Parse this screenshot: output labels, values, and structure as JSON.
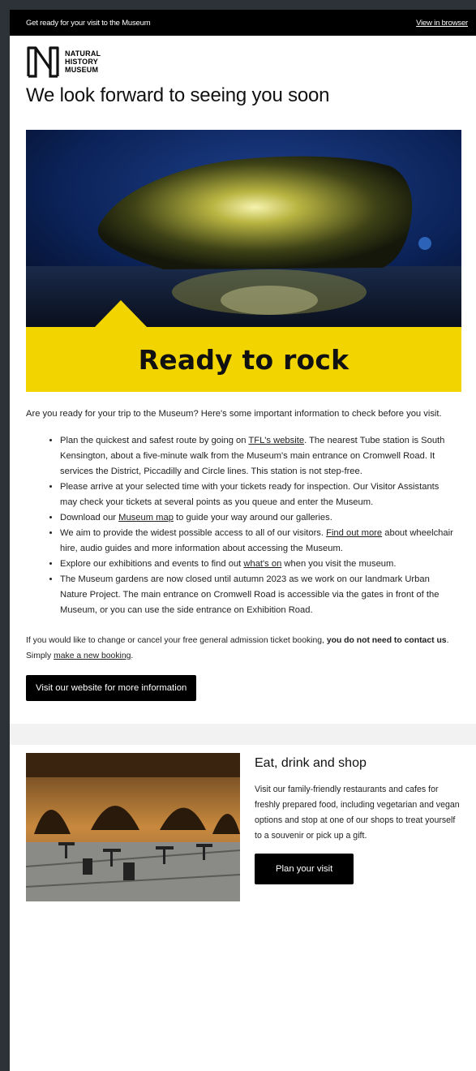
{
  "topbar": {
    "preheader": "Get ready for your visit to the Museum",
    "view_in_browser": "View in browser"
  },
  "logo": {
    "line1": "NATURAL",
    "line2": "HISTORY",
    "line3": "MUSEUM"
  },
  "heading": "We look forward to seeing you soon",
  "hero": {
    "title": "Ready to rock",
    "colors": {
      "band": "#f2d400",
      "background": "#0a1f4a"
    }
  },
  "intro": "Are you ready for your trip to the Museum? Here's some important information to check before you visit.",
  "bullets": [
    {
      "before": "Plan the quickest and safest route by going on ",
      "link": "TFL's website",
      "after": ". The nearest Tube station is South Kensington, about a five-minute walk from the Museum's main entrance on Cromwell Road. It services the District, Piccadilly and Circle lines. This station is not step-free."
    },
    {
      "before": "Please arrive at your selected time with your tickets ready for inspection. Our Visitor Assistants may check your tickets at several points as you queue and enter the Museum.",
      "link": "",
      "after": ""
    },
    {
      "before": "Download our ",
      "link": "Museum map",
      "after": " to guide your way around our galleries."
    },
    {
      "before": "We aim to provide the widest possible access to all of our visitors. ",
      "link": "Find out more",
      "after": " about wheelchair hire, audio guides and more information about accessing the Museum."
    },
    {
      "before": "Explore our exhibitions and events to find out ",
      "link": "what's on",
      "after": " when you visit the museum."
    },
    {
      "before": "The Museum gardens are now closed until autumn 2023 as we work on our landmark Urban Nature Project. The main entrance on Cromwell Road is accessible via the gates in front of the Museum, or you can use the side entrance on Exhibition Road.",
      "link": "",
      "after": ""
    }
  ],
  "notice": {
    "before": "If you would like to change or cancel your free general admission ticket booking, ",
    "bold": "you do not need to contact us",
    "middle": ". Simply ",
    "link": "make a new booking",
    "after": "."
  },
  "cta_label": "Visit our website for more information",
  "eat": {
    "title": "Eat, drink and shop",
    "text": "Visit our family-friendly restaurants and cafes for freshly prepared food, including vegetarian and vegan options and stop at one of our shops to treat yourself to a souvenir or pick up a gift.",
    "button": "Plan your visit"
  }
}
